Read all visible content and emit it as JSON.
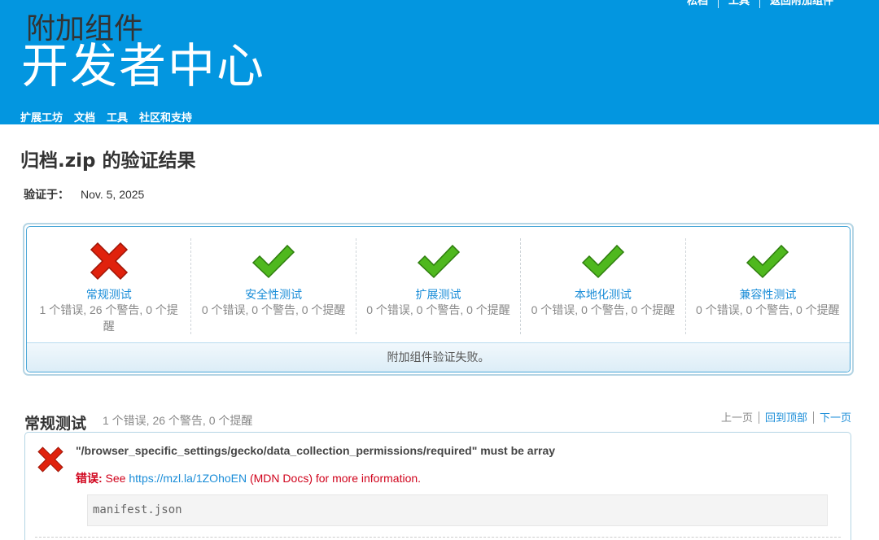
{
  "header": {
    "top_links": [
      "松档",
      "工具",
      "返回附加组件"
    ],
    "subtitle": "附加组件",
    "title": "开发者中心",
    "nav": [
      "扩展工坊",
      "文档",
      "工具",
      "社区和支持"
    ]
  },
  "page": {
    "title": "归档.zip 的验证结果",
    "validated_label": "验证于：",
    "validated_date": "Nov. 5, 2025"
  },
  "summary": {
    "tests": [
      {
        "name": "常规测试",
        "status": "fail",
        "counts": "1 个错误, 26 个警告, 0 个提醒"
      },
      {
        "name": "安全性测试",
        "status": "pass",
        "counts": "0 个错误, 0 个警告, 0 个提醒"
      },
      {
        "name": "扩展测试",
        "status": "pass",
        "counts": "0 个错误, 0 个警告, 0 个提醒"
      },
      {
        "name": "本地化测试",
        "status": "pass",
        "counts": "0 个错误, 0 个警告, 0 个提醒"
      },
      {
        "name": "兼容性测试",
        "status": "pass",
        "counts": "0 个错误, 0 个警告, 0 个提醒"
      }
    ],
    "result": "附加组件验证失败。"
  },
  "section": {
    "title": "常规测试",
    "counts": "1 个错误, 26 个警告, 0 个提醒",
    "pager": {
      "prev": "上一页",
      "top": "回到顶部",
      "next": "下一页"
    }
  },
  "message": {
    "title": "\"/browser_specific_settings/gecko/data_collection_permissions/required\" must be array",
    "error_label": "错误:",
    "error_pre": " See ",
    "error_link": "https://mzl.la/1ZOhoEN",
    "error_post": " (MDN Docs) for more information.",
    "file": "manifest.json"
  },
  "colors": {
    "header_bg": "#0396e0",
    "link": "#1a8dd8",
    "error": "#d0021b",
    "pass": "#4fb81e",
    "fail": "#e0220d"
  },
  "icons": {
    "pass": "check-icon",
    "fail": "x-icon"
  }
}
